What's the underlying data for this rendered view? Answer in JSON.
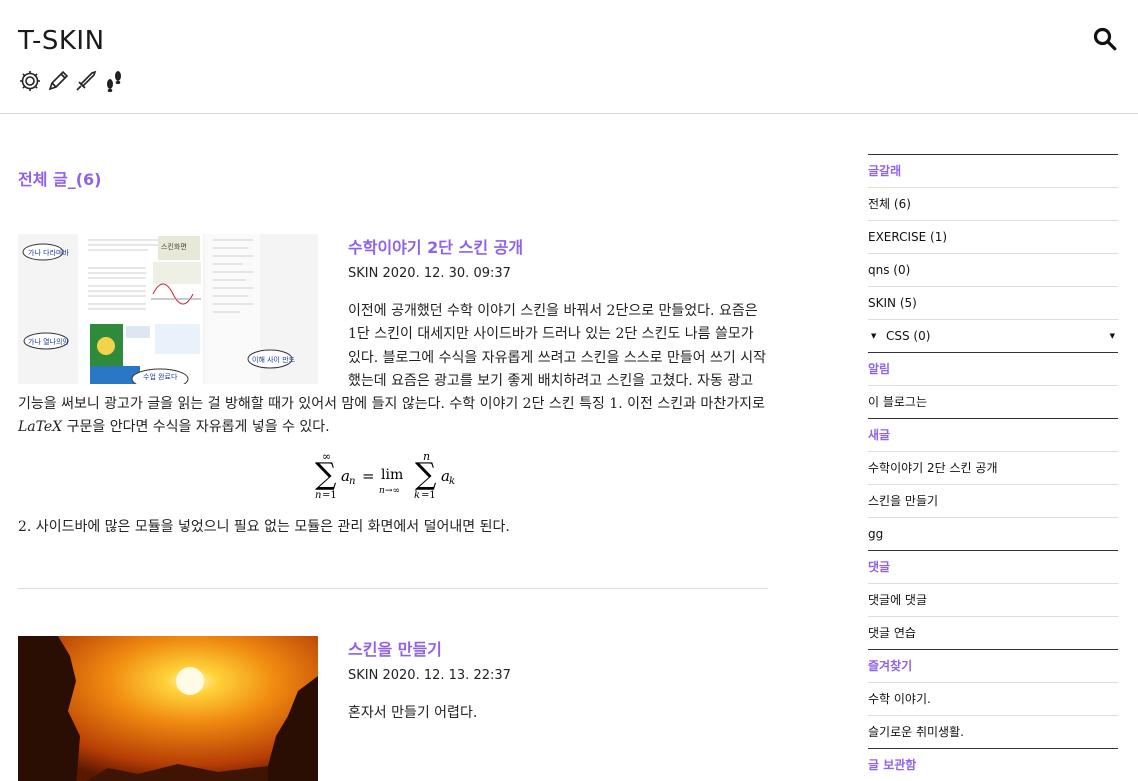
{
  "header": {
    "title": "T-SKIN",
    "tools": [
      "gear-icon",
      "pencil-icon",
      "sword-icon",
      "footprints-icon"
    ],
    "search_icon": "search-icon"
  },
  "main": {
    "category_title": "전체 글",
    "category_count": "_(6)",
    "posts": [
      {
        "title": "수학이야기 2단 스킨 공개",
        "category": "SKIN",
        "date": "2020. 12. 30. 09:37",
        "body_before": "이전에 공개했던 수학 이야기 스킨을 바꿔서 2단으로 만들었다. 요즘은 1단 스킨이 대세지만 사이드바가 드러나 있는 2단 스킨도 나름 쓸모가 있다. 블로그에 수식을 자유롭게 쓰려고 스킨을 스스로 만들어 쓰기 시작했는데 요즘은 광고를 보기 좋게 배치하려고 스킨을 고쳤다. 자동 광고 기능을 써보니 광고가 글을 읽는 걸 방해할 때가 있어서 맘에 들지 않는다. 수학 이야기 2단 스킨 특징 1. 이전 스킨과 마찬가지로",
        "latex": "LaTeX",
        "body_after": " 구문을 안다면 수식을 자유롭게 넣을 수 있다.",
        "body2": "2. 사이드바에 많은 모듈을 넣었으니 필요 없는 모듈은 관리 화면에서 덜어내면 된다.",
        "thumb_bubbles": [
          "가나 다라마바",
          "가나 열나의양",
          "이해 사이 만드",
          "수업 완료다"
        ]
      },
      {
        "title": "스킨을 만들기",
        "category": "SKIN",
        "date": "2020. 12. 13. 22:37",
        "body": "혼자서 만들기 어렵다."
      }
    ]
  },
  "sidebar": {
    "sections": [
      {
        "heading": "글갈래",
        "items": [
          "전체 (6)",
          "EXERCISE (1)",
          "qns (0)",
          "SKIN (5)",
          "CSS (0)"
        ]
      },
      {
        "heading": "알림",
        "items": [
          "이 블로그는"
        ]
      },
      {
        "heading": "새글",
        "items": [
          "수학이야기 2단 스킨 공개",
          "스킨을 만들기",
          "gg"
        ]
      },
      {
        "heading": "댓글",
        "items": [
          "댓글에 댓글",
          "댓글 연습"
        ]
      },
      {
        "heading": "즐겨찾기",
        "items": [
          "수학 이야기.",
          "슬기로운 취미생활."
        ]
      },
      {
        "heading": "글 보관함",
        "items": []
      }
    ]
  },
  "colors": {
    "accent": "#8f62e8",
    "text": "#222222",
    "divider": "#dcdcdc"
  }
}
